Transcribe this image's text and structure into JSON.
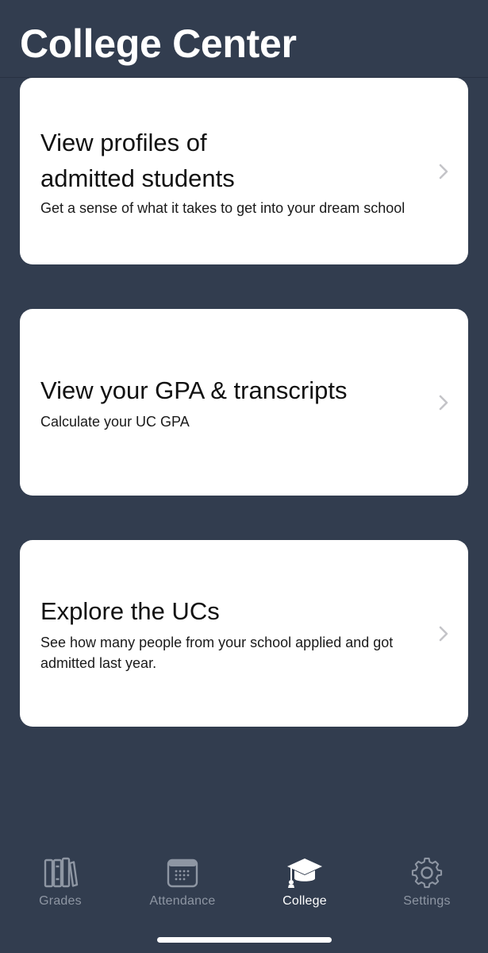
{
  "header": {
    "title": "College Center"
  },
  "cards": [
    {
      "title_line1": "View profiles of",
      "title_line2": "admitted students",
      "description": "Get a sense of what it takes to get into your dream school"
    },
    {
      "title": "View your GPA & transcripts",
      "description": "Calculate your UC GPA"
    },
    {
      "title": "Explore the UCs",
      "description": "See how many people from your school applied and got admitted last year."
    }
  ],
  "tabbar": {
    "tabs": [
      {
        "label": "Grades",
        "icon": "books-icon",
        "active": false
      },
      {
        "label": "Attendance",
        "icon": "calendar-icon",
        "active": false
      },
      {
        "label": "College",
        "icon": "graduation-cap-icon",
        "active": true
      },
      {
        "label": "Settings",
        "icon": "gear-icon",
        "active": false
      }
    ]
  },
  "colors": {
    "background": "#323d4f",
    "card": "#ffffff",
    "tab_inactive": "#8e96a3",
    "tab_active": "#ffffff",
    "chevron": "#c4c4c8"
  }
}
